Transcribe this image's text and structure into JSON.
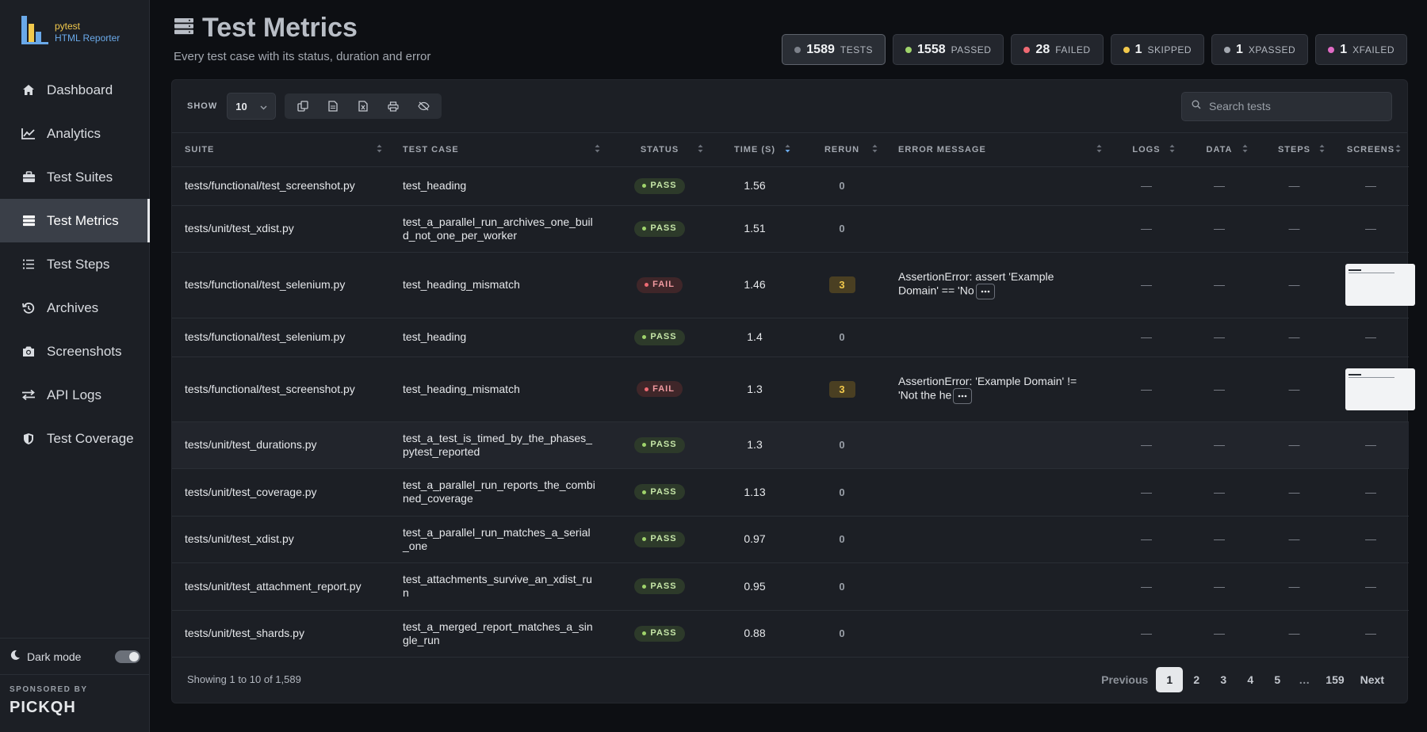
{
  "logo": {
    "line1": "pytest",
    "line2": "HTML Reporter"
  },
  "sidebar": {
    "items": [
      {
        "label": "Dashboard",
        "icon": "home-icon"
      },
      {
        "label": "Analytics",
        "icon": "line-chart-icon"
      },
      {
        "label": "Test Suites",
        "icon": "briefcase-icon"
      },
      {
        "label": "Test Metrics",
        "icon": "server-list-icon",
        "active": true
      },
      {
        "label": "Test Steps",
        "icon": "list-icon"
      },
      {
        "label": "Archives",
        "icon": "history-icon"
      },
      {
        "label": "Screenshots",
        "icon": "camera-icon"
      },
      {
        "label": "API Logs",
        "icon": "exchange-icon"
      },
      {
        "label": "Test Coverage",
        "icon": "shield-icon"
      }
    ],
    "dark_mode_label": "Dark mode",
    "sponsor_label": "SPONSORED BY",
    "sponsor_brand": "PICKQH"
  },
  "header": {
    "title": "Test Metrics",
    "subtitle": "Every test case with its status, duration and error"
  },
  "stats": [
    {
      "num": "1589",
      "label": "TESTS",
      "color": "#7c818a"
    },
    {
      "num": "1558",
      "label": "PASSED",
      "color": "#9fd36b"
    },
    {
      "num": "28",
      "label": "FAILED",
      "color": "#ef6a73"
    },
    {
      "num": "1",
      "label": "SKIPPED",
      "color": "#f2c94c"
    },
    {
      "num": "1",
      "label": "XPASSED",
      "color": "#a3a8b0"
    },
    {
      "num": "1",
      "label": "XFAILED",
      "color": "#e06bc4"
    }
  ],
  "toolbar": {
    "show_label": "SHOW",
    "page_size": "10",
    "search_placeholder": "Search tests",
    "buttons": [
      "copy-icon",
      "csv-icon",
      "excel-icon",
      "print-icon",
      "column-visibility-icon"
    ]
  },
  "columns": [
    "SUITE",
    "TEST CASE",
    "STATUS",
    "TIME (S)",
    "RERUN",
    "ERROR MESSAGE",
    "LOGS",
    "DATA",
    "STEPS",
    "SCREENS"
  ],
  "rows": [
    {
      "suite": "tests/functional/test_screenshot.py",
      "case": "test_heading",
      "status": "PASS",
      "time": "1.56",
      "rerun": "0",
      "error": "",
      "logs": "—",
      "data": "—",
      "steps": "—",
      "screens": "—"
    },
    {
      "suite": "tests/unit/test_xdist.py",
      "case": "test_a_parallel_run_archives_one_build_not_one_per_worker",
      "status": "PASS",
      "time": "1.51",
      "rerun": "0",
      "error": "",
      "logs": "—",
      "data": "—",
      "steps": "—",
      "screens": "—"
    },
    {
      "suite": "tests/functional/test_selenium.py",
      "case": "test_heading_mismatch",
      "status": "FAIL",
      "time": "1.46",
      "rerun": "3",
      "error": "AssertionError: assert 'Example Domain' == 'No",
      "logs": "—",
      "data": "—",
      "steps": "—",
      "screens": "thumb"
    },
    {
      "suite": "tests/functional/test_selenium.py",
      "case": "test_heading",
      "status": "PASS",
      "time": "1.4",
      "rerun": "0",
      "error": "",
      "logs": "—",
      "data": "—",
      "steps": "—",
      "screens": "—"
    },
    {
      "suite": "tests/functional/test_screenshot.py",
      "case": "test_heading_mismatch",
      "status": "FAIL",
      "time": "1.3",
      "rerun": "3",
      "error": "AssertionError: 'Example Domain' != 'Not the he",
      "logs": "—",
      "data": "—",
      "steps": "—",
      "screens": "thumb"
    },
    {
      "suite": "tests/unit/test_durations.py",
      "case": "test_a_test_is_timed_by_the_phases_pytest_reported",
      "status": "PASS",
      "time": "1.3",
      "rerun": "0",
      "error": "",
      "logs": "—",
      "data": "—",
      "steps": "—",
      "screens": "—"
    },
    {
      "suite": "tests/unit/test_coverage.py",
      "case": "test_a_parallel_run_reports_the_combined_coverage",
      "status": "PASS",
      "time": "1.13",
      "rerun": "0",
      "error": "",
      "logs": "—",
      "data": "—",
      "steps": "—",
      "screens": "—"
    },
    {
      "suite": "tests/unit/test_xdist.py",
      "case": "test_a_parallel_run_matches_a_serial_one",
      "status": "PASS",
      "time": "0.97",
      "rerun": "0",
      "error": "",
      "logs": "—",
      "data": "—",
      "steps": "—",
      "screens": "—"
    },
    {
      "suite": "tests/unit/test_attachment_report.py",
      "case": "test_attachments_survive_an_xdist_run",
      "status": "PASS",
      "time": "0.95",
      "rerun": "0",
      "error": "",
      "logs": "—",
      "data": "—",
      "steps": "—",
      "screens": "—"
    },
    {
      "suite": "tests/unit/test_shards.py",
      "case": "test_a_merged_report_matches_a_single_run",
      "status": "PASS",
      "time": "0.88",
      "rerun": "0",
      "error": "",
      "logs": "—",
      "data": "—",
      "steps": "—",
      "screens": "—"
    }
  ],
  "footer": {
    "showing": "Showing 1 to 10 of 1,589",
    "previous": "Previous",
    "pages": [
      "1",
      "2",
      "3",
      "4",
      "5",
      "…",
      "159"
    ],
    "current_page": "1",
    "next": "Next"
  }
}
